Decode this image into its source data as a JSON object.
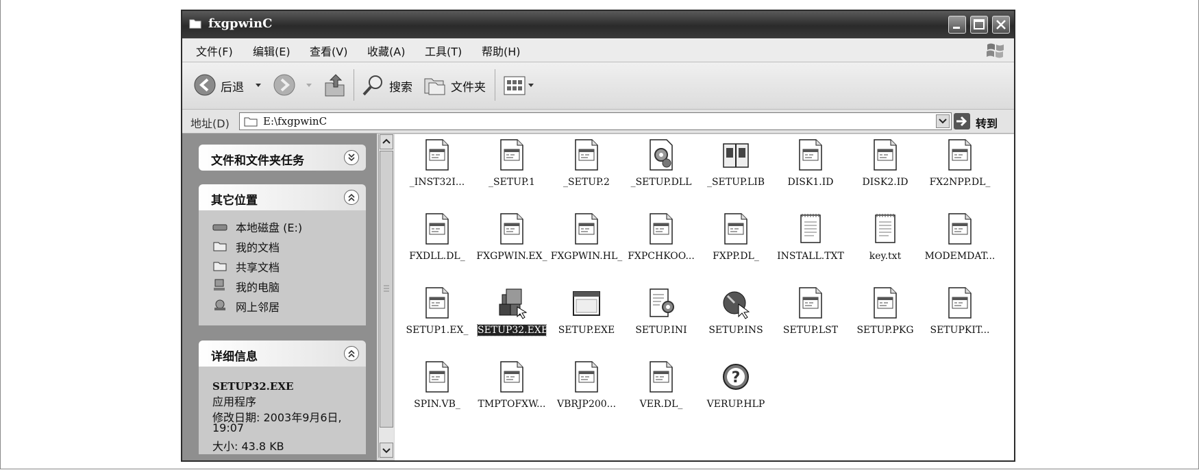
{
  "window": {
    "title": "fxgpwinC"
  },
  "menu": [
    "文件(F)",
    "编辑(E)",
    "查看(V)",
    "收藏(A)",
    "工具(T)",
    "帮助(H)"
  ],
  "toolbar": {
    "back_label": "后退",
    "search_label": "搜索",
    "folders_label": "文件夹"
  },
  "address": {
    "label": "地址(D)",
    "value": "E:\\fxgpwinC",
    "go_label": "转到"
  },
  "panels": {
    "tasks_title": "文件和文件夹任务",
    "places_title": "其它位置",
    "places": [
      {
        "label": "本地磁盘 (E:)",
        "icon": "drive-icon"
      },
      {
        "label": "我的文档",
        "icon": "documents-icon"
      },
      {
        "label": "共享文档",
        "icon": "shared-folder-icon"
      },
      {
        "label": "我的电脑",
        "icon": "computer-icon"
      },
      {
        "label": "网上邻居",
        "icon": "network-icon"
      }
    ],
    "details_title": "详细信息",
    "details": {
      "name": "SETUP32.EXE",
      "type": "应用程序",
      "modified_label": "修改日期: 2003年9月6日,",
      "modified_time": "19:07",
      "size": "大小: 43.8 KB"
    }
  },
  "files": [
    {
      "name": "_INST32I...",
      "icon": "generic-file-icon"
    },
    {
      "name": "_SETUP.1",
      "icon": "generic-file-icon"
    },
    {
      "name": "_SETUP.2",
      "icon": "generic-file-icon"
    },
    {
      "name": "_SETUP.DLL",
      "icon": "dll-gear-icon"
    },
    {
      "name": "_SETUP.LIB",
      "icon": "library-book-icon"
    },
    {
      "name": "DISK1.ID",
      "icon": "generic-file-icon"
    },
    {
      "name": "DISK2.ID",
      "icon": "generic-file-icon"
    },
    {
      "name": "FX2NPP.DL_",
      "icon": "generic-file-icon"
    },
    {
      "name": "FXDLL.DL_",
      "icon": "generic-file-icon"
    },
    {
      "name": "FXGPWIN.EX_",
      "icon": "generic-file-icon"
    },
    {
      "name": "FXGPWIN.HL_",
      "icon": "generic-file-icon"
    },
    {
      "name": "FXPCHKOO...",
      "icon": "generic-file-icon"
    },
    {
      "name": "FXPP.DL_",
      "icon": "generic-file-icon"
    },
    {
      "name": "INSTALL.TXT",
      "icon": "text-file-icon"
    },
    {
      "name": "key.txt",
      "icon": "text-file-icon"
    },
    {
      "name": "MODEMDAT...",
      "icon": "generic-file-icon"
    },
    {
      "name": "SETUP1.EX_",
      "icon": "generic-file-icon"
    },
    {
      "name": "SETUP32.EXE",
      "icon": "installer-icon",
      "selected": true
    },
    {
      "name": "SETUP.EXE",
      "icon": "app-window-icon"
    },
    {
      "name": "SETUP.INI",
      "icon": "ini-settings-icon"
    },
    {
      "name": "SETUP.INS",
      "icon": "ins-script-icon"
    },
    {
      "name": "SETUP.LST",
      "icon": "generic-file-icon"
    },
    {
      "name": "SETUP.PKG",
      "icon": "generic-file-icon"
    },
    {
      "name": "SETUPKIT...",
      "icon": "generic-file-icon"
    },
    {
      "name": "SPIN.VB_",
      "icon": "generic-file-icon"
    },
    {
      "name": "TMPTOFXW...",
      "icon": "generic-file-icon"
    },
    {
      "name": "VBRJP200...",
      "icon": "generic-file-icon"
    },
    {
      "name": "VER.DL_",
      "icon": "generic-file-icon"
    },
    {
      "name": "VERUP.HLP",
      "icon": "help-icon"
    }
  ]
}
